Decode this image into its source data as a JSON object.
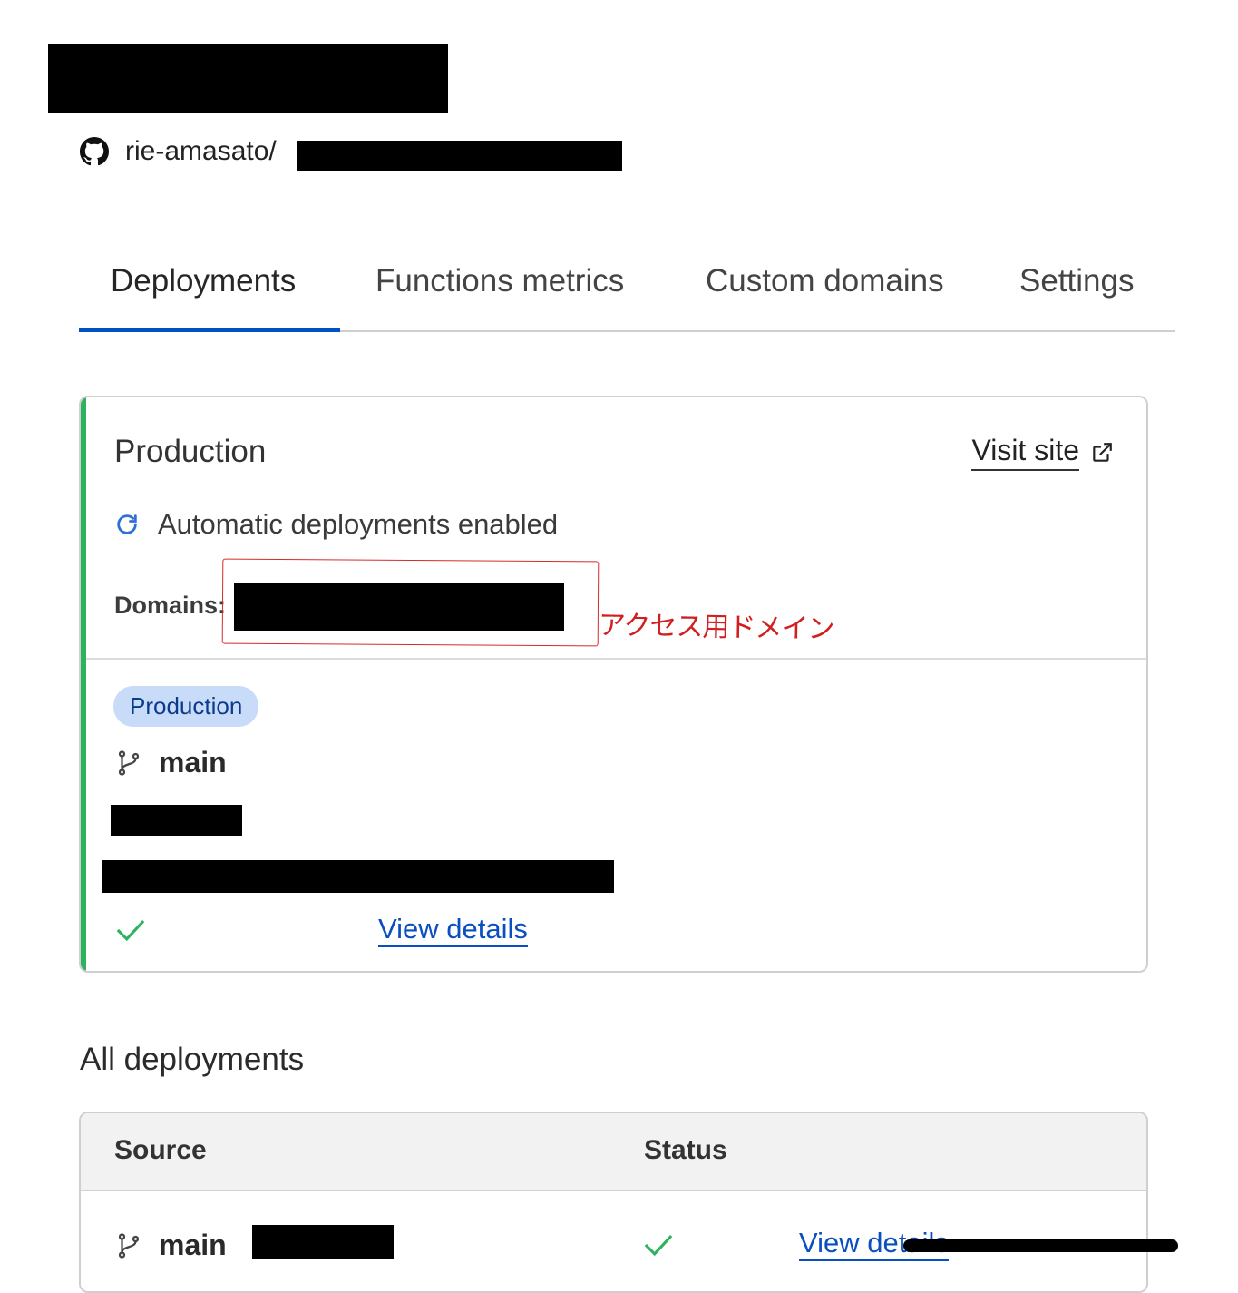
{
  "repo": {
    "owner_path": "rie-amasato/"
  },
  "tabs": [
    {
      "label": "Deployments"
    },
    {
      "label": "Functions metrics"
    },
    {
      "label": "Custom domains"
    },
    {
      "label": "Settings"
    }
  ],
  "production": {
    "title": "Production",
    "visit_site": "Visit site",
    "auto_deploy": "Automatic deployments enabled",
    "domains_label": "Domains:",
    "badge": "Production",
    "branch": "main",
    "view_details": "View details"
  },
  "annotation": {
    "text": "アクセス用ドメイン",
    "color": "#d11f1f"
  },
  "all_deployments": {
    "title": "All deployments",
    "columns": {
      "source": "Source",
      "status": "Status"
    },
    "rows": [
      {
        "branch": "main",
        "view_details": "View details"
      }
    ]
  },
  "colors": {
    "accent": "#0051c3",
    "success": "#2db35d",
    "link": "#0a4fbf"
  }
}
